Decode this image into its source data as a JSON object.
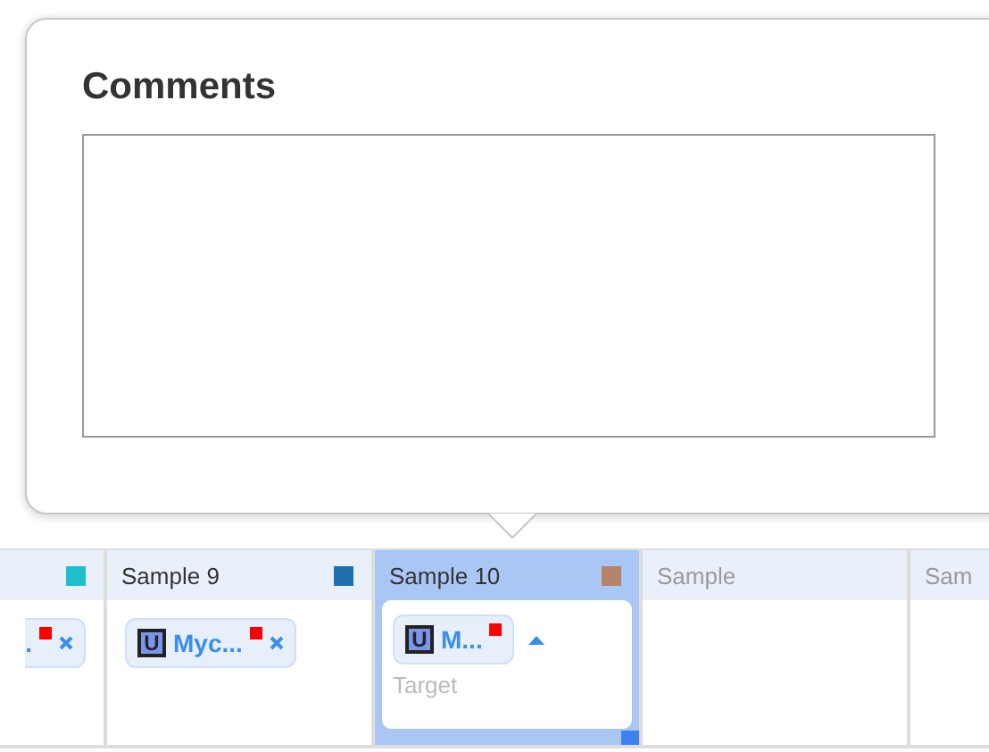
{
  "popover": {
    "title": "Comments"
  },
  "columns": [
    {
      "kind": "sample",
      "color": "#1fbfcc",
      "selected": false,
      "chips": [
        {
          "label": ".",
          "removable": true
        }
      ]
    },
    {
      "kind": "sample",
      "header": "Sample 9",
      "color": "#1f6fae",
      "selected": false,
      "chips": [
        {
          "badge": "U",
          "label": "Myc...",
          "removable": true
        }
      ]
    },
    {
      "kind": "sample",
      "header": "Sample 10",
      "color": "#b5826b",
      "selected": true,
      "chips": [
        {
          "badge": "U",
          "label": "M...",
          "removable": false
        }
      ],
      "input_placeholder": "Target"
    },
    {
      "kind": "empty",
      "header": "Sample",
      "selected": false
    },
    {
      "kind": "empty",
      "header": "Sam",
      "selected": false
    }
  ]
}
